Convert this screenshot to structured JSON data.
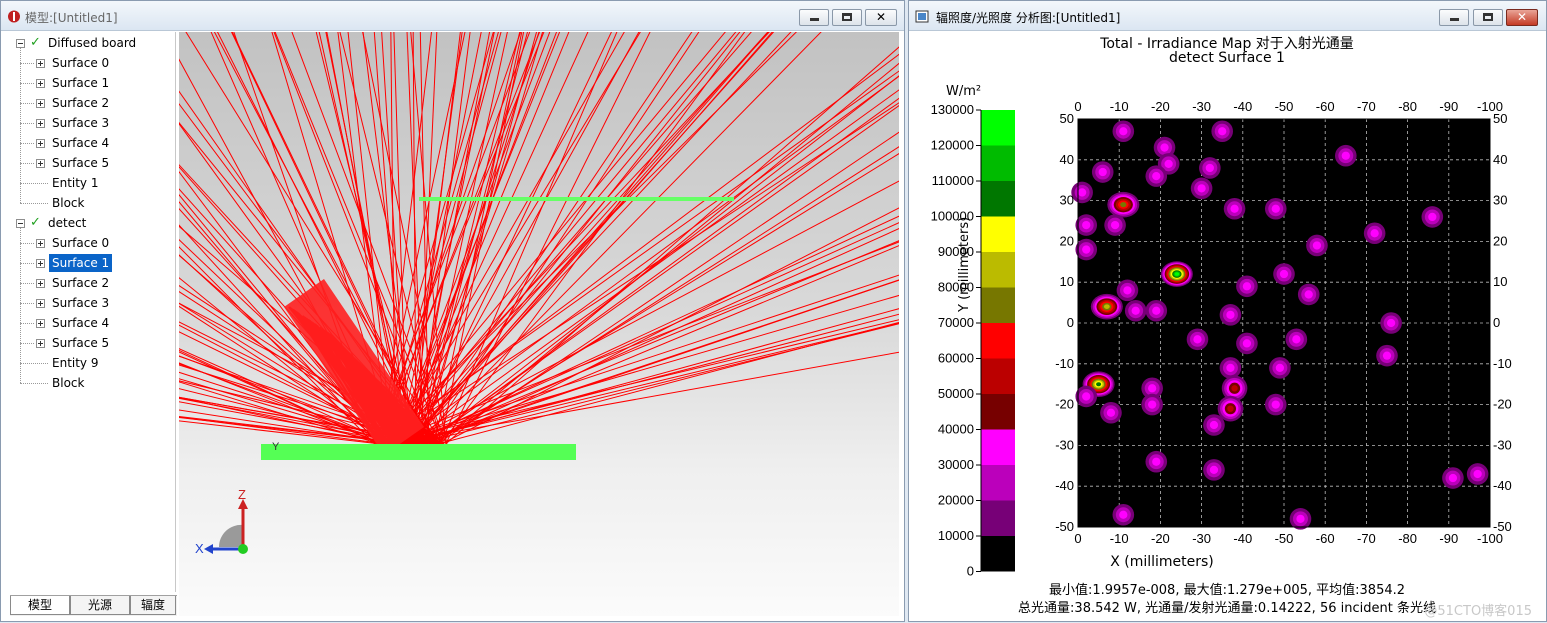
{
  "left_window": {
    "title": "模型:[Untitled1]",
    "tree": [
      {
        "label": "Diffused board",
        "level": 0,
        "checked": true
      },
      {
        "label": "Surface 0",
        "level": 1
      },
      {
        "label": "Surface 1",
        "level": 1
      },
      {
        "label": "Surface 2",
        "level": 1
      },
      {
        "label": "Surface 3",
        "level": 1
      },
      {
        "label": "Surface 4",
        "level": 1
      },
      {
        "label": "Surface 5",
        "level": 1
      },
      {
        "label": "Entity 1",
        "level": 1,
        "leaf": true
      },
      {
        "label": "Block",
        "level": 1,
        "leaf": true
      },
      {
        "label": "detect",
        "level": 0,
        "checked": true
      },
      {
        "label": "Surface 0",
        "level": 1
      },
      {
        "label": "Surface 1",
        "level": 1,
        "selected": true
      },
      {
        "label": "Surface 2",
        "level": 1
      },
      {
        "label": "Surface 3",
        "level": 1
      },
      {
        "label": "Surface 4",
        "level": 1
      },
      {
        "label": "Surface 5",
        "level": 1
      },
      {
        "label": "Entity 9",
        "level": 1,
        "leaf": true
      },
      {
        "label": "Block",
        "level": 1,
        "leaf": true
      }
    ],
    "tabs": [
      "模型",
      "光源",
      "辐度"
    ],
    "axis": {
      "z": "Z",
      "x": "X",
      "y": "Y"
    }
  },
  "right_window": {
    "title": "辐照度/光照度 分析图:[Untitled1]",
    "plot_title": "Total - Irradiance Map 对于入射光通量",
    "plot_subtitle": "detect Surface 1",
    "colorbar_unit": "W/m²",
    "colorbar_ticks": [
      "130000",
      "120000",
      "110000",
      "100000",
      "90000",
      "80000",
      "70000",
      "60000",
      "50000",
      "40000",
      "30000",
      "20000",
      "10000",
      "0"
    ],
    "colorbar_colors": [
      "#00ff00",
      "#00bb00",
      "#007700",
      "#ffff00",
      "#bbbb00",
      "#777700",
      "#ff0000",
      "#bb0000",
      "#770000",
      "#ff00ff",
      "#bb00bb",
      "#770077",
      "#000000"
    ],
    "x_ticks": [
      "0",
      "-10",
      "-20",
      "-30",
      "-40",
      "-50",
      "-60",
      "-70",
      "-80",
      "-90",
      "-100"
    ],
    "y_ticks": [
      "50",
      "40",
      "30",
      "20",
      "10",
      "0",
      "-10",
      "-20",
      "-30",
      "-40",
      "-50"
    ],
    "xlabel": "X (millimeters)",
    "ylabel": "Y (millimeters)",
    "stats_line1": "最小值:1.9957e-008, 最大值:1.279e+005, 平均值:3854.2",
    "stats_line2": "总光通量:38.542 W, 光通量/发射光通量:0.14222, 56 incident 条光线",
    "watermark": "@51CTO博客015"
  },
  "chart_data": {
    "type": "heatmap",
    "title": "Total - Irradiance Map 对于入射光通量",
    "subtitle": "detect Surface 1",
    "xlabel": "X (millimeters)",
    "ylabel": "Y (millimeters)",
    "xlim": [
      0,
      -100
    ],
    "ylim": [
      -50,
      50
    ],
    "colorbar_range": [
      0,
      130000
    ],
    "colorbar_unit": "W/m²",
    "spots": [
      {
        "x": -11,
        "y": 47,
        "peak": 30000
      },
      {
        "x": -35,
        "y": 47,
        "peak": 30000
      },
      {
        "x": -21,
        "y": 43,
        "peak": 30000
      },
      {
        "x": -65,
        "y": 41,
        "peak": 30000
      },
      {
        "x": -22,
        "y": 39,
        "peak": 30000
      },
      {
        "x": -32,
        "y": 38,
        "peak": 30000
      },
      {
        "x": -6,
        "y": 37,
        "peak": 30000
      },
      {
        "x": -19,
        "y": 36,
        "peak": 30000
      },
      {
        "x": -30,
        "y": 33,
        "peak": 30000
      },
      {
        "x": -1,
        "y": 32,
        "peak": 30000
      },
      {
        "x": -11,
        "y": 29,
        "peak": 70000
      },
      {
        "x": -38,
        "y": 28,
        "peak": 30000
      },
      {
        "x": -48,
        "y": 28,
        "peak": 30000
      },
      {
        "x": -86,
        "y": 26,
        "peak": 30000
      },
      {
        "x": -2,
        "y": 24,
        "peak": 30000
      },
      {
        "x": -9,
        "y": 24,
        "peak": 30000
      },
      {
        "x": -72,
        "y": 22,
        "peak": 30000
      },
      {
        "x": -58,
        "y": 19,
        "peak": 30000
      },
      {
        "x": -2,
        "y": 18,
        "peak": 30000
      },
      {
        "x": -24,
        "y": 12,
        "peak": 120000
      },
      {
        "x": -50,
        "y": 12,
        "peak": 30000
      },
      {
        "x": -41,
        "y": 9,
        "peak": 30000
      },
      {
        "x": -12,
        "y": 8,
        "peak": 30000
      },
      {
        "x": -56,
        "y": 7,
        "peak": 30000
      },
      {
        "x": -7,
        "y": 4,
        "peak": 80000
      },
      {
        "x": -14,
        "y": 3,
        "peak": 30000
      },
      {
        "x": -19,
        "y": 3,
        "peak": 30000
      },
      {
        "x": -37,
        "y": 2,
        "peak": 30000
      },
      {
        "x": -76,
        "y": 0,
        "peak": 30000
      },
      {
        "x": -29,
        "y": -4,
        "peak": 30000
      },
      {
        "x": -41,
        "y": -5,
        "peak": 30000
      },
      {
        "x": -53,
        "y": -4,
        "peak": 30000
      },
      {
        "x": -75,
        "y": -8,
        "peak": 30000
      },
      {
        "x": -37,
        "y": -11,
        "peak": 30000
      },
      {
        "x": -49,
        "y": -11,
        "peak": 30000
      },
      {
        "x": -5,
        "y": -15,
        "peak": 100000
      },
      {
        "x": -2,
        "y": -18,
        "peak": 30000
      },
      {
        "x": -18,
        "y": -16,
        "peak": 30000
      },
      {
        "x": -38,
        "y": -16,
        "peak": 50000
      },
      {
        "x": -37,
        "y": -21,
        "peak": 50000
      },
      {
        "x": -18,
        "y": -20,
        "peak": 30000
      },
      {
        "x": -48,
        "y": -20,
        "peak": 30000
      },
      {
        "x": -8,
        "y": -22,
        "peak": 30000
      },
      {
        "x": -33,
        "y": -25,
        "peak": 30000
      },
      {
        "x": -19,
        "y": -34,
        "peak": 30000
      },
      {
        "x": -33,
        "y": -36,
        "peak": 30000
      },
      {
        "x": -91,
        "y": -38,
        "peak": 30000
      },
      {
        "x": -97,
        "y": -37,
        "peak": 30000
      },
      {
        "x": -11,
        "y": -47,
        "peak": 30000
      },
      {
        "x": -54,
        "y": -48,
        "peak": 30000
      }
    ]
  }
}
